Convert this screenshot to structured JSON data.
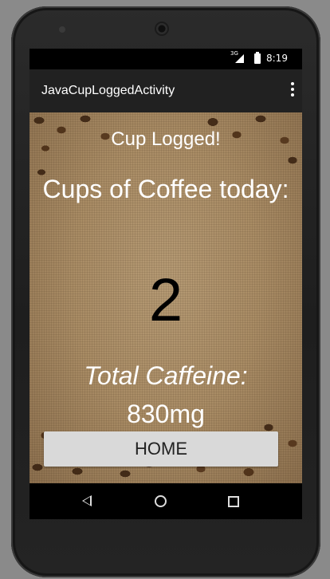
{
  "status_bar": {
    "network": "3G",
    "time": "8:19"
  },
  "app_bar": {
    "title": "JavaCupLoggedActivity",
    "overflow_icon": "more-vert-icon"
  },
  "content": {
    "message": "Cup Logged!",
    "cups_label": "Cups of Coffee today:",
    "cups_count": "2",
    "caffeine_label": "Total Caffeine:",
    "caffeine_value": "830mg",
    "home_button_label": "HOME"
  },
  "nav_bar": {
    "back_icon": "back-icon",
    "home_icon": "home-icon",
    "recents_icon": "recents-icon"
  }
}
